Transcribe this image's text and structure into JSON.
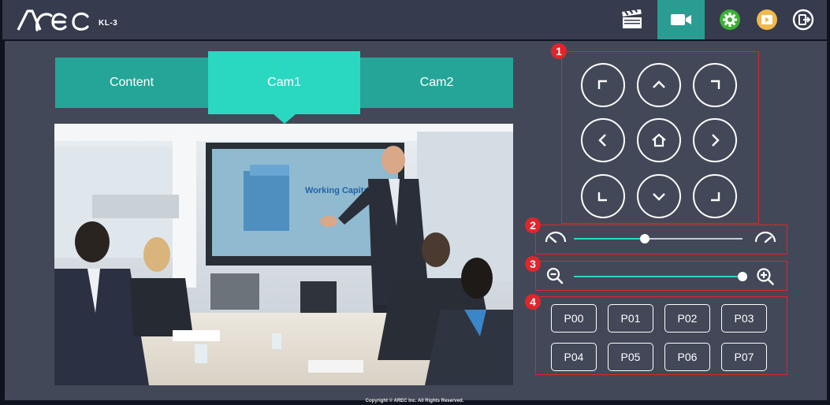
{
  "header": {
    "logo_text": "AREC",
    "model": "KL-3",
    "icons": [
      "clapperboard-icon",
      "camera-icon",
      "settings-icon",
      "media-player-icon",
      "logout-icon"
    ],
    "accent_color": "#2a9c92"
  },
  "tabs": [
    {
      "label": "Content",
      "active": false
    },
    {
      "label": "Cam1",
      "active": true
    },
    {
      "label": "Cam2",
      "active": false
    }
  ],
  "video": {
    "screen_text": "Working Capital"
  },
  "sections": {
    "ptz_badge": "1",
    "speed_badge": "2",
    "zoom_badge": "3",
    "preset_badge": "4"
  },
  "speed_slider": {
    "value": 0.42
  },
  "zoom_slider": {
    "value": 1.0
  },
  "presets": [
    "P00",
    "P01",
    "P02",
    "P03",
    "P04",
    "P05",
    "P06",
    "P07"
  ],
  "footer": {
    "copyright": "Copyright © AREC Inc. All Rights Reserved."
  },
  "colors": {
    "tab": "#25a597",
    "tab_active": "#2ad8c1",
    "panel": "#424858",
    "topbar": "#363b4d",
    "badge": "#e0252b"
  }
}
